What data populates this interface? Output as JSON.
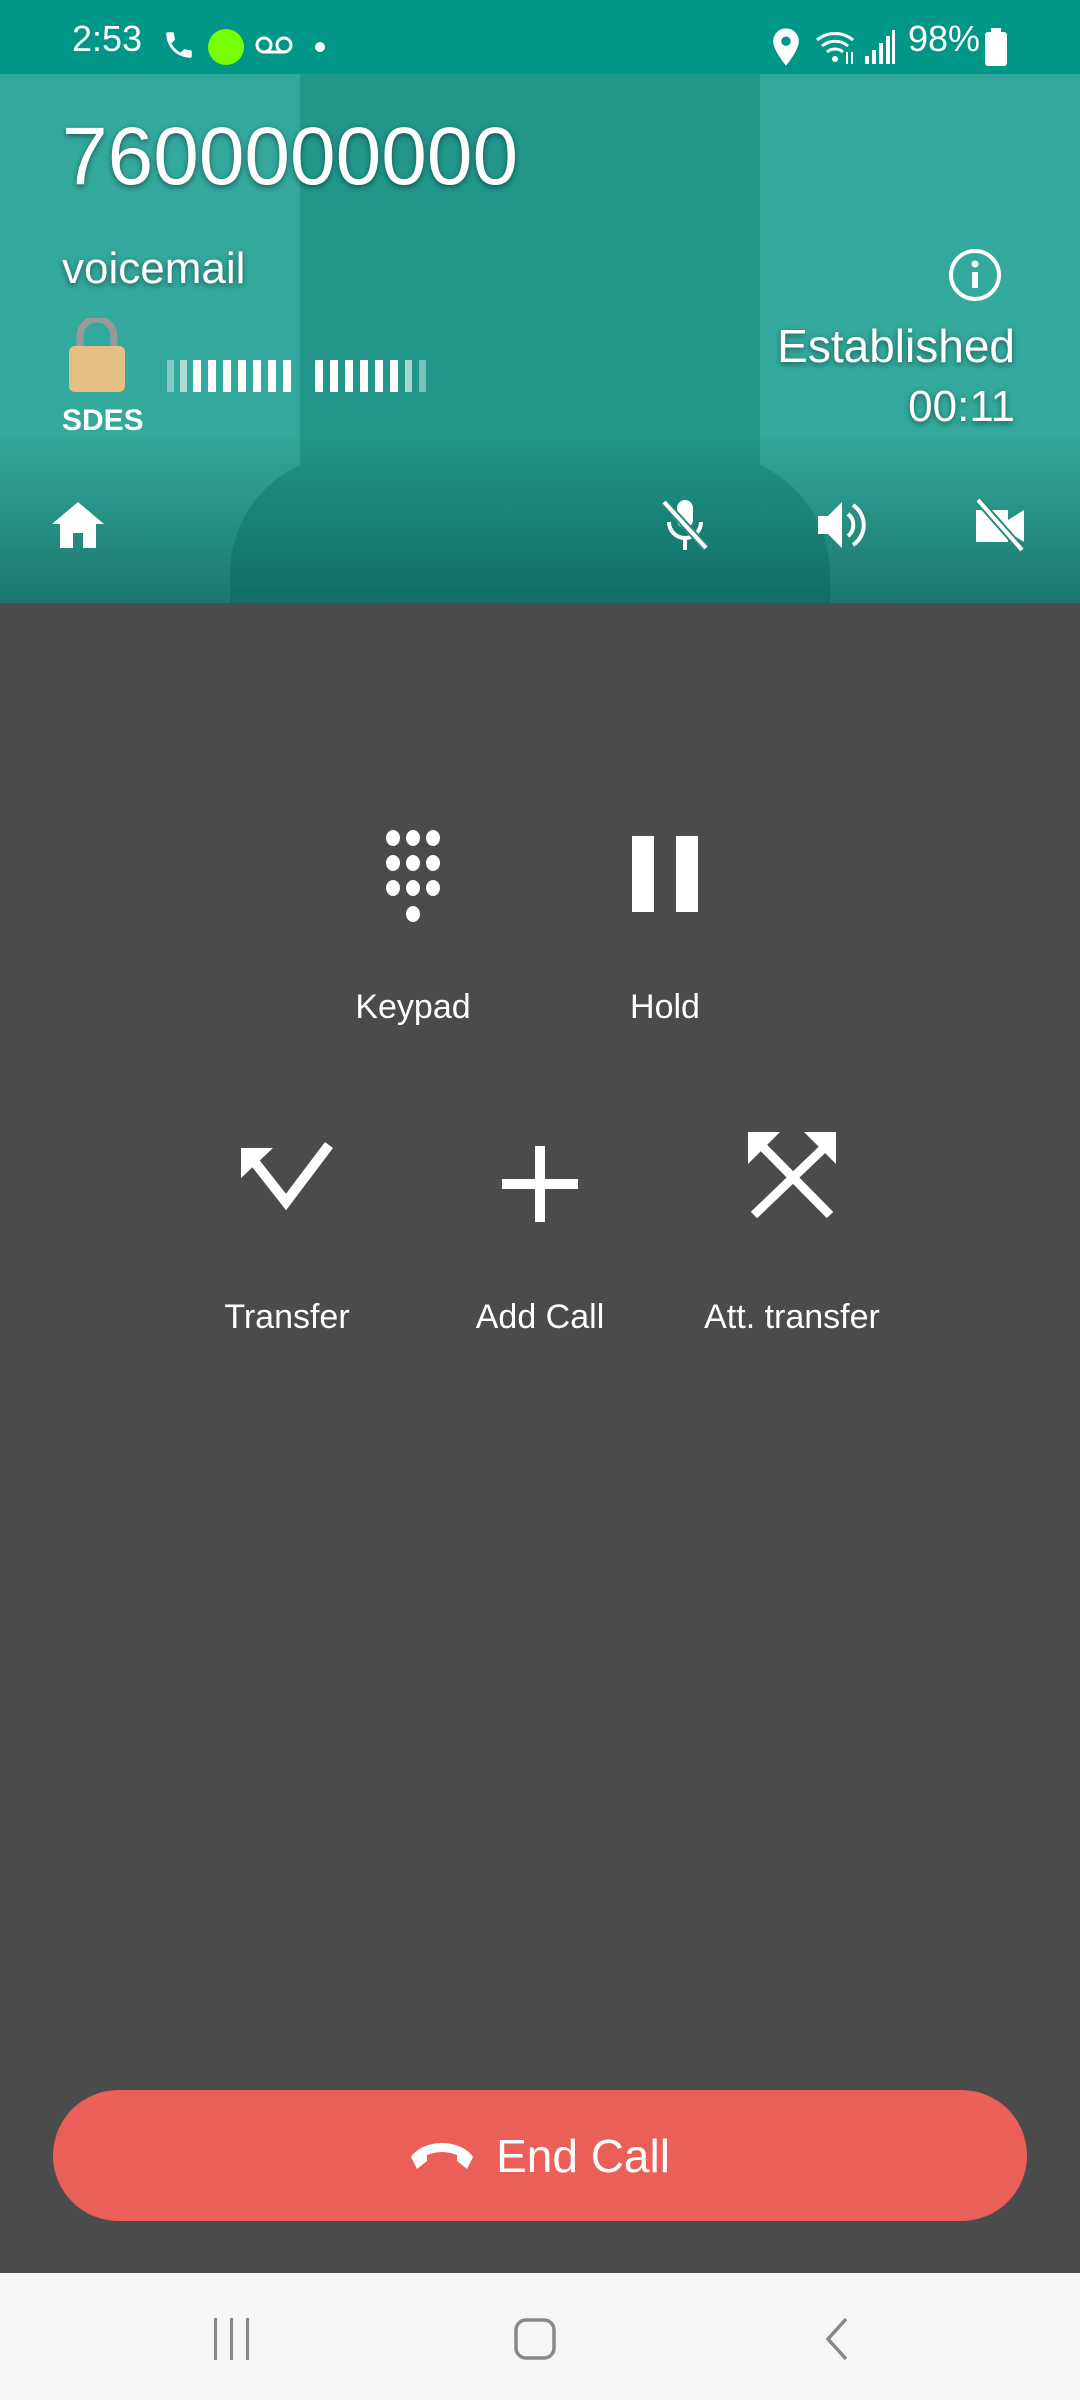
{
  "status_bar": {
    "time": "2:53",
    "battery": "98%",
    "icons": [
      "phone-icon",
      "green-dot",
      "voicemail-icon",
      "dot-icon",
      "location-icon",
      "wifi-icon",
      "signal-icon",
      "battery-icon"
    ],
    "dot_color": "#76ff03"
  },
  "call": {
    "number": "7600000000",
    "name": "voicemail",
    "encryption": "SDES",
    "state": "Established",
    "duration": "00:11"
  },
  "toolbar": {
    "icons": [
      "home-icon",
      "mic-off-icon",
      "speaker-icon",
      "video-off-icon"
    ]
  },
  "actions": [
    {
      "label": "Keypad",
      "icon": "dialpad-icon"
    },
    {
      "label": "Hold",
      "icon": "pause-icon"
    },
    {
      "label": "Transfer",
      "icon": "transfer-icon"
    },
    {
      "label": "Add Call",
      "icon": "add-icon"
    },
    {
      "label": "Att. transfer",
      "icon": "attended-transfer-icon"
    }
  ],
  "end_call": {
    "label": "End Call",
    "color": "#ea5f57"
  },
  "colors": {
    "status_bar": "#009688",
    "header": "#33a89c",
    "background": "#4b4b4b"
  }
}
